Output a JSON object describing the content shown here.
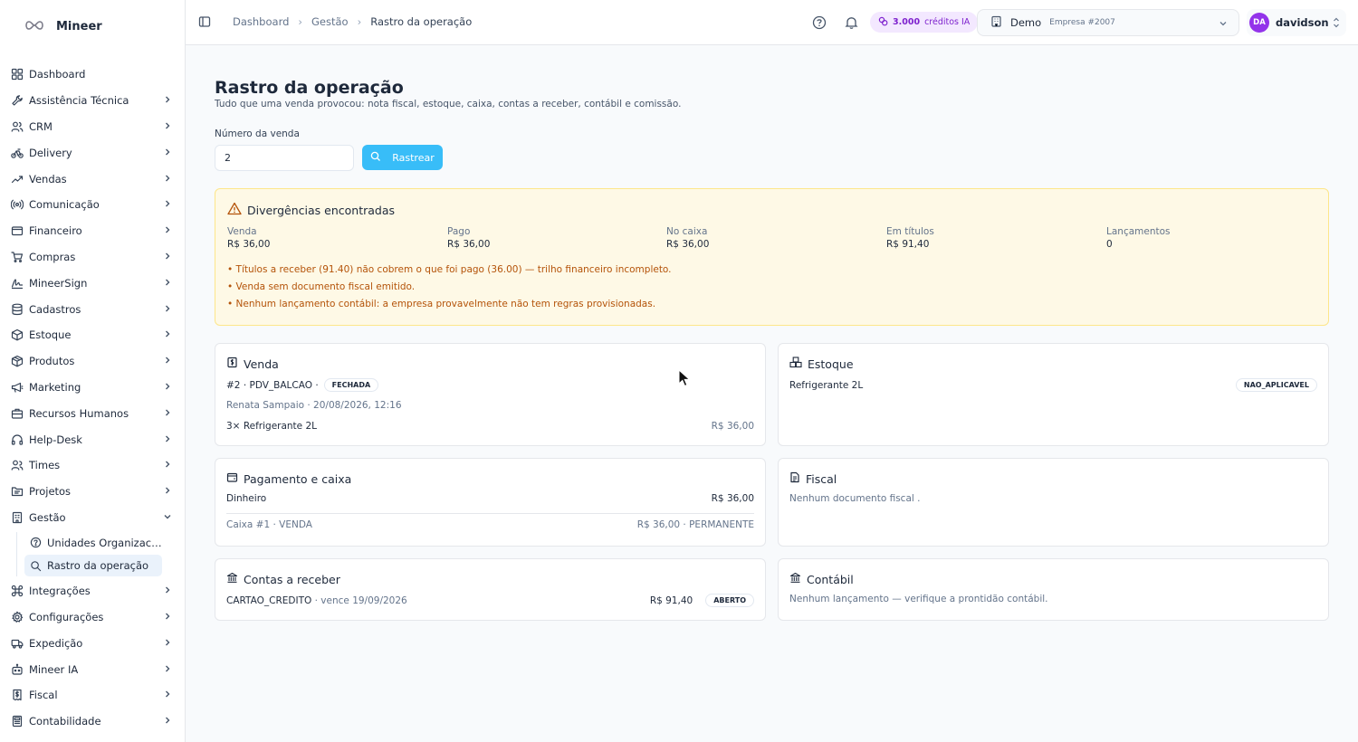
{
  "brand": {
    "name": "Mineer"
  },
  "sidebar": {
    "items": [
      {
        "label": "Dashboard",
        "icon": "grid-icon"
      },
      {
        "label": "Assistência Técnica",
        "icon": "wrench-icon"
      },
      {
        "label": "CRM",
        "icon": "users-icon"
      },
      {
        "label": "Delivery",
        "icon": "bike-icon"
      },
      {
        "label": "Vendas",
        "icon": "trending-up-icon"
      },
      {
        "label": "Comunicação",
        "icon": "radio-icon"
      },
      {
        "label": "Financeiro",
        "icon": "wallet-icon"
      },
      {
        "label": "Compras",
        "icon": "cart-icon"
      },
      {
        "label": "MineerSign",
        "icon": "signature-icon"
      },
      {
        "label": "Cadastros",
        "icon": "database-icon"
      },
      {
        "label": "Estoque",
        "icon": "package-icon"
      },
      {
        "label": "Produtos",
        "icon": "box-icon"
      },
      {
        "label": "Marketing",
        "icon": "megaphone-icon"
      },
      {
        "label": "Recursos Humanos",
        "icon": "briefcase-icon"
      },
      {
        "label": "Help-Desk",
        "icon": "headphones-icon"
      },
      {
        "label": "Times",
        "icon": "team-icon"
      },
      {
        "label": "Projetos",
        "icon": "folder-icon"
      },
      {
        "label": "Gestão",
        "icon": "building-icon"
      }
    ],
    "gestao_sub": [
      {
        "label": "Unidades Organizaci...",
        "icon": "help-circle-icon"
      },
      {
        "label": "Rastro da operação",
        "icon": "search-icon"
      }
    ],
    "items_after": [
      {
        "label": "Integrações",
        "icon": "command-icon"
      },
      {
        "label": "Configurações",
        "icon": "gear-icon"
      },
      {
        "label": "Expedição",
        "icon": "truck-icon"
      },
      {
        "label": "Mineer IA",
        "icon": "bot-icon"
      },
      {
        "label": "Fiscal",
        "icon": "receipt-icon"
      },
      {
        "label": "Contabilidade",
        "icon": "calculator-icon"
      }
    ]
  },
  "topbar": {
    "breadcrumb": [
      "Dashboard",
      "Gestão",
      "Rastro da operação"
    ],
    "credits_value": "3.000",
    "credits_label": "créditos IA",
    "company_name": "Demo",
    "company_sub": "Empresa #2007",
    "user_initials": "DA",
    "user_name": "davidson"
  },
  "page": {
    "title": "Rastro da operação",
    "subtitle": "Tudo que uma venda provocou: nota fiscal, estoque, caixa, contas a receber, contábil e comissão.",
    "sale_label": "Número da venda",
    "sale_value": "2",
    "track_button": "Rastrear"
  },
  "alert": {
    "title": "Divergências encontradas",
    "metrics": [
      {
        "label": "Venda",
        "value": "R$ 36,00"
      },
      {
        "label": "Pago",
        "value": "R$ 36,00"
      },
      {
        "label": "No caixa",
        "value": "R$ 36,00"
      },
      {
        "label": "Em títulos",
        "value": "R$ 91,40"
      },
      {
        "label": "Lançamentos",
        "value": "0"
      }
    ],
    "warnings": [
      "• Títulos a receber (91.40) não cobrem o que foi pago (36.00) — trilho financeiro incompleto.",
      "• Venda sem documento fiscal emitido.",
      "• Nenhum lançamento contábil: a empresa provavelmente não tem regras provisionadas."
    ]
  },
  "cards": {
    "venda": {
      "title": "Venda",
      "ref": "#2 · PDV_BALCAO ·",
      "status": "FECHADA",
      "meta": "Renata Sampaio · 20/08/2026, 12:16",
      "item": "3× Refrigerante 2L",
      "item_value": "R$ 36,00"
    },
    "estoque": {
      "title": "Estoque",
      "item": "Refrigerante 2L",
      "status": "NAO_APLICAVEL"
    },
    "pagamento": {
      "title": "Pagamento e caixa",
      "method": "Dinheiro",
      "method_value": "R$ 36,00",
      "caixa": "Caixa #1 · VENDA",
      "caixa_value": "R$ 36,00 · PERMANENTE"
    },
    "fiscal": {
      "title": "Fiscal",
      "text": "Nenhum documento fiscal ."
    },
    "contas": {
      "title": "Contas a receber",
      "method": "CARTAO_CREDITO",
      "due": "· vence 19/09/2026",
      "value": "R$ 91,40",
      "status": "ABERTO"
    },
    "contabil": {
      "title": "Contábil",
      "text": "Nenhum lançamento — verifique a prontidão contábil."
    }
  },
  "colors": {
    "accent": "#38bdf8",
    "alert_bg": "#fef9e6",
    "warning_text": "#b45309",
    "credits": "#7e22ce"
  }
}
